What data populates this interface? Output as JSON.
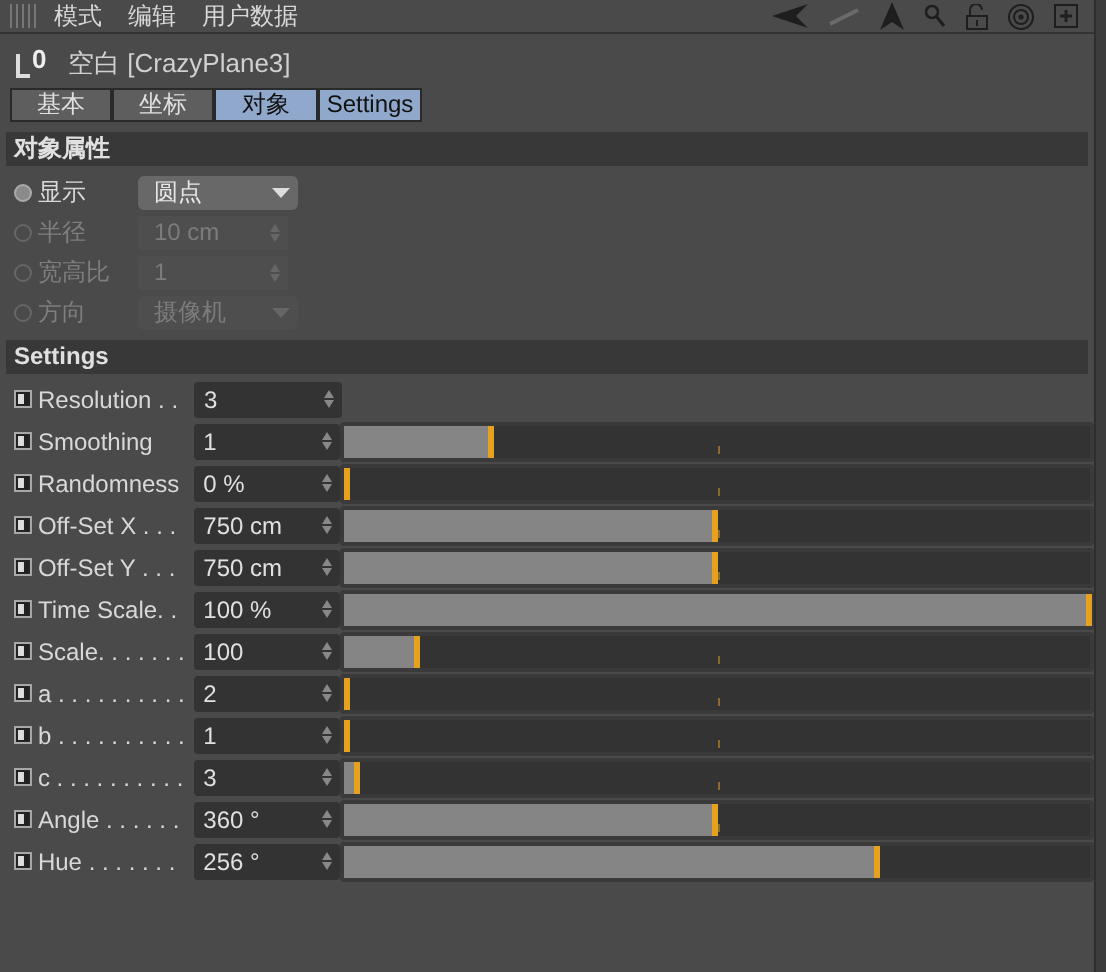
{
  "menu": [
    "模式",
    "编辑",
    "用户数据"
  ],
  "title": {
    "icon_text": "0",
    "text": "空白 [CrazyPlane3]"
  },
  "tabs": [
    {
      "label": "基本",
      "selected": false
    },
    {
      "label": "坐标",
      "selected": false
    },
    {
      "label": "对象",
      "selected": true
    },
    {
      "label": "Settings",
      "selected": true
    }
  ],
  "object_section": {
    "title": "对象属性",
    "rows": [
      {
        "label": "显示",
        "kind": "dropdown",
        "value": "圆点",
        "disabled": false
      },
      {
        "label": "半径",
        "kind": "spinner",
        "value": "10 cm",
        "disabled": true
      },
      {
        "label": "宽高比",
        "kind": "spinner",
        "value": "1",
        "disabled": true
      },
      {
        "label": "方向",
        "kind": "dropdown",
        "value": "摄像机",
        "disabled": true
      }
    ]
  },
  "settings_section": {
    "title": "Settings",
    "rows": [
      {
        "label": "Resolution . .",
        "value": "3",
        "kind": "spinner"
      },
      {
        "label": "Smoothing",
        "value": "1",
        "kind": "slider",
        "level": 0.2
      },
      {
        "label": "Randomness",
        "value": "0 %",
        "kind": "slider",
        "level": 0
      },
      {
        "label": "Off-Set X . . .",
        "value": "750 cm",
        "kind": "slider",
        "level": 0.5
      },
      {
        "label": "Off-Set Y . . .",
        "value": "750 cm",
        "kind": "slider",
        "level": 0.5
      },
      {
        "label": "Time Scale. .",
        "value": "100 %",
        "kind": "slider",
        "level": 1
      },
      {
        "label": "Scale. . . . . . .",
        "value": "100",
        "kind": "slider",
        "level": 0.1
      },
      {
        "label": "a . . . . . . . . . .",
        "value": "2",
        "kind": "slider",
        "level": 0
      },
      {
        "label": "b . . . . . . . . . .",
        "value": "1",
        "kind": "slider",
        "level": 0
      },
      {
        "label": "c . . . . . . . . . .",
        "value": "3",
        "kind": "slider",
        "level": 0.02
      },
      {
        "label": "Angle . . . . . .",
        "value": "360 °",
        "kind": "slider",
        "level": 0.5
      },
      {
        "label": "Hue  . . . . . . .",
        "value": "256 °",
        "kind": "slider",
        "level": 0.715
      }
    ]
  }
}
